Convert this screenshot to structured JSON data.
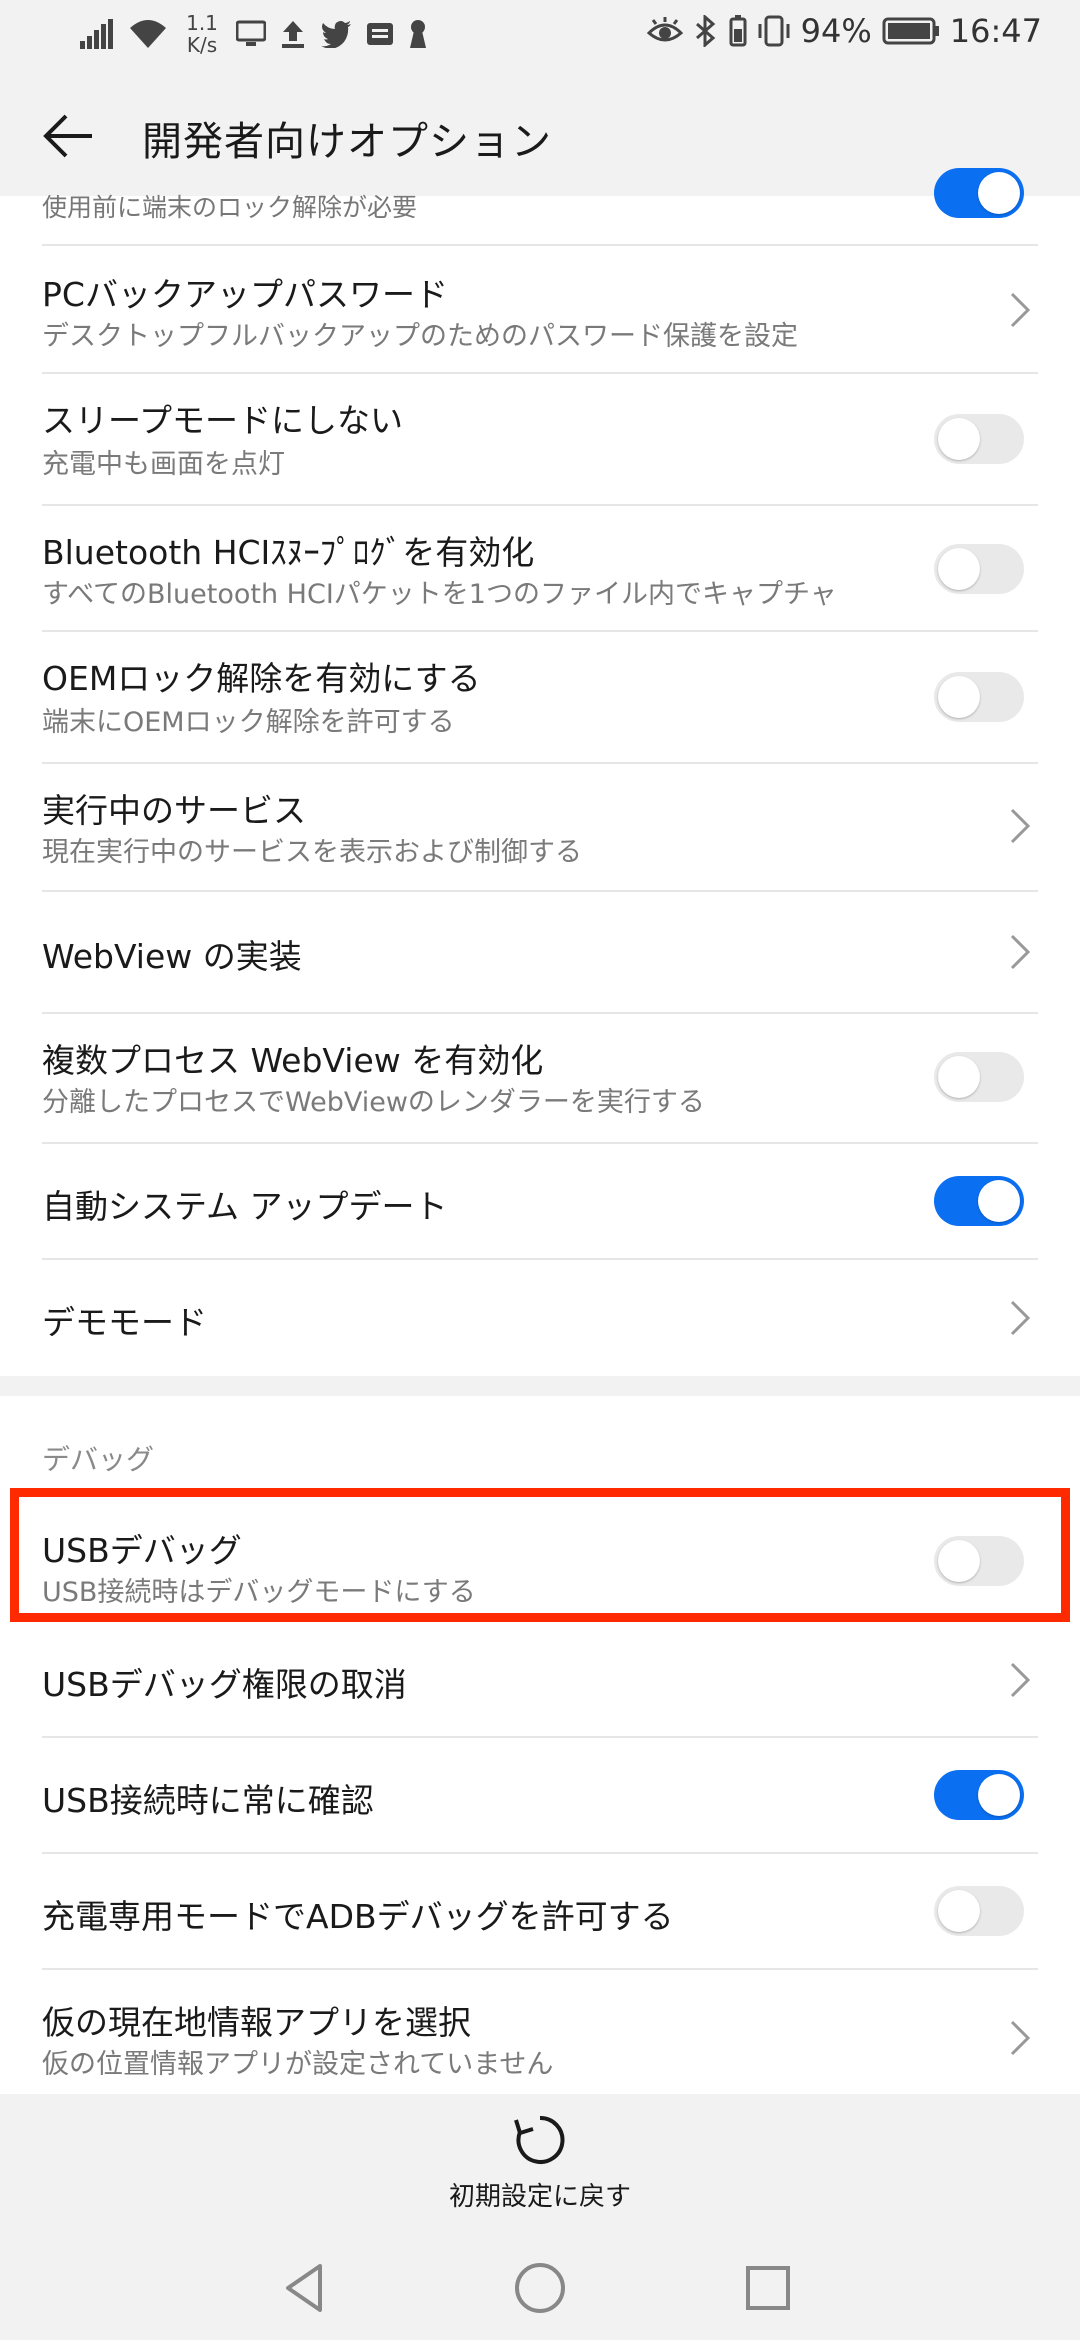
{
  "status_bar": {
    "speed_value": "1.1",
    "speed_unit": "K/s",
    "battery": "94%",
    "time": "16:47",
    "icons": [
      "signal-icon",
      "wifi-icon",
      "screen-cast-icon",
      "upload-icon",
      "twitter-icon",
      "news-icon",
      "keyhole-icon",
      "eye-icon",
      "bluetooth-icon",
      "vibrate-icon",
      "battery-icon"
    ]
  },
  "header": {
    "title": "開発者向けオプション",
    "back_icon": "arrow-left-icon"
  },
  "list": {
    "partial_top": "使用前に端末のロック解除が必要",
    "items": [
      {
        "title": "PCバックアップパスワード",
        "subtitle": "デスクトップフルバックアップのためのパスワード保護を設定",
        "control": "chevron"
      },
      {
        "title": "スリープモードにしない",
        "subtitle": "充電中も画面を点灯",
        "control": "toggle",
        "on": false
      },
      {
        "title": "Bluetooth HCIｽﾇｰﾌﾟﾛｸﾞを有効化",
        "subtitle": "すべてのBluetooth HCIパケットを1つのファイル内でキャプチャ",
        "control": "toggle",
        "on": false
      },
      {
        "title": "OEMロック解除を有効にする",
        "subtitle": "端末にOEMロック解除を許可する",
        "control": "toggle",
        "on": false
      },
      {
        "title": "実行中のサービス",
        "subtitle": "現在実行中のサービスを表示および制御する",
        "control": "chevron"
      },
      {
        "title": "WebView の実装",
        "control": "chevron"
      },
      {
        "title": "複数プロセス WebView を有効化",
        "subtitle": "分離したプロセスでWebViewのレンダラーを実行する",
        "control": "toggle",
        "on": false
      },
      {
        "title": "自動システム アップデート",
        "control": "toggle",
        "on": true
      },
      {
        "title": "デモモード",
        "control": "chevron"
      }
    ]
  },
  "debug_section": {
    "header": "デバッグ",
    "items": [
      {
        "title": "USBデバッグ",
        "subtitle": "USB接続時はデバッグモードにする",
        "control": "toggle",
        "on": false,
        "highlighted": true
      },
      {
        "title": "USBデバッグ権限の取消",
        "control": "chevron"
      },
      {
        "title": "USB接続時に常に確認",
        "control": "toggle",
        "on": true
      },
      {
        "title": "充電専用モードでADBデバッグを許可する",
        "control": "toggle",
        "on": false
      },
      {
        "title": "仮の現在地情報アプリを選択",
        "subtitle": "仮の位置情報アプリが設定されていません",
        "control": "chevron"
      }
    ]
  },
  "footer": {
    "reset_label": "初期設定に戻す",
    "reset_icon": "refresh-icon"
  },
  "nav_bar": {
    "back_icon": "nav-back-icon",
    "home_icon": "nav-home-icon",
    "recents_icon": "nav-recents-icon"
  },
  "colors": {
    "accent": "#0B6FF2",
    "highlight": "#FF2A00",
    "background": "#F2F2F2"
  }
}
